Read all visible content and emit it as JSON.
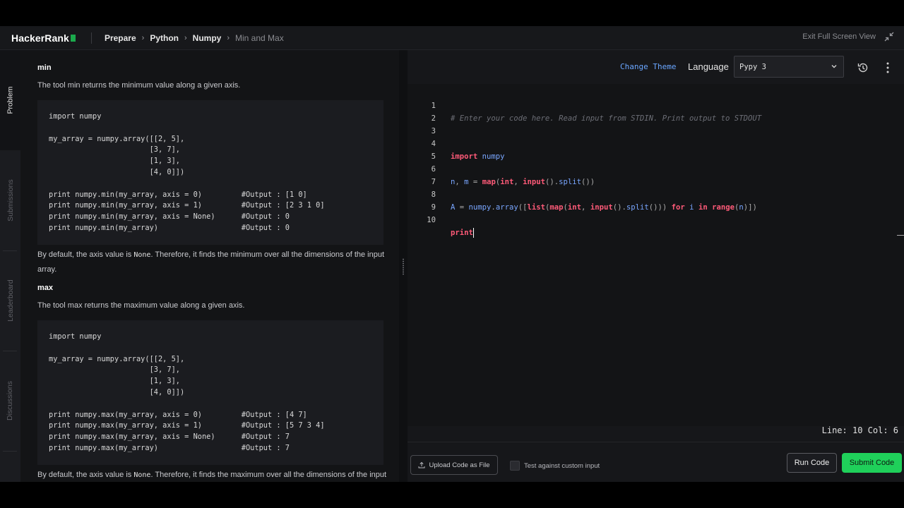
{
  "header": {
    "logo": "HackerRank",
    "breadcrumbs": [
      "Prepare",
      "Python",
      "Numpy",
      "Min and Max"
    ],
    "exit_fullscreen": "Exit Full Screen View"
  },
  "side_tabs": [
    "Problem",
    "Submissions",
    "Leaderboard",
    "Discussions"
  ],
  "problem": {
    "min_heading": "min",
    "min_desc": "The tool min returns the minimum value along a given axis.",
    "min_code": "import numpy\n\nmy_array = numpy.array([[2, 5], \n                       [3, 7],\n                       [1, 3],\n                       [4, 0]])\n\nprint numpy.min(my_array, axis = 0)         #Output : [1 0]\nprint numpy.min(my_array, axis = 1)         #Output : [2 3 1 0]\nprint numpy.min(my_array, axis = None)      #Output : 0\nprint numpy.min(my_array)                   #Output : 0",
    "min_note_pre": "By default, the axis value is ",
    "min_note_code": "None",
    "min_note_post": ". Therefore, it finds the minimum over all the dimensions of the input array.",
    "max_heading": "max",
    "max_desc": "The tool max returns the maximum value along a given axis.",
    "max_code": "import numpy\n\nmy_array = numpy.array([[2, 5], \n                       [3, 7],\n                       [1, 3],\n                       [4, 0]])\n\nprint numpy.max(my_array, axis = 0)         #Output : [4 7]\nprint numpy.max(my_array, axis = 1)         #Output : [5 7 3 4]\nprint numpy.max(my_array, axis = None)      #Output : 7\nprint numpy.max(my_array)                   #Output : 7",
    "max_note_pre": "By default, the axis value is ",
    "max_note_code": "None",
    "max_note_post": ". Therefore, it finds the maximum over all the dimensions of the input"
  },
  "editor": {
    "change_theme": "Change Theme",
    "language_label": "Language",
    "language_value": "Pypy 3",
    "status": "Line: 10 Col: 6",
    "lines": [
      {
        "n": "1",
        "src": "# Enter your code here. Read input from STDIN. Print output to STDOUT"
      },
      {
        "n": "2",
        "src": ""
      },
      {
        "n": "3",
        "src": ""
      },
      {
        "n": "4",
        "src": "import numpy"
      },
      {
        "n": "5",
        "src": ""
      },
      {
        "n": "6",
        "src": "n, m = map(int, input().split())"
      },
      {
        "n": "7",
        "src": ""
      },
      {
        "n": "8",
        "src": "A = numpy.array([list(map(int, input().split())) for i in range(n)])"
      },
      {
        "n": "9",
        "src": ""
      },
      {
        "n": "10",
        "src": "print"
      }
    ]
  },
  "footer": {
    "upload": "Upload Code as File",
    "custom_input": "Test against custom input",
    "run": "Run Code",
    "submit": "Submit Code"
  },
  "colors": {
    "accent_green": "#1fd05a",
    "keyword": "#ff5a78",
    "identifier": "#79a6ff",
    "link": "#6aa6ff"
  }
}
